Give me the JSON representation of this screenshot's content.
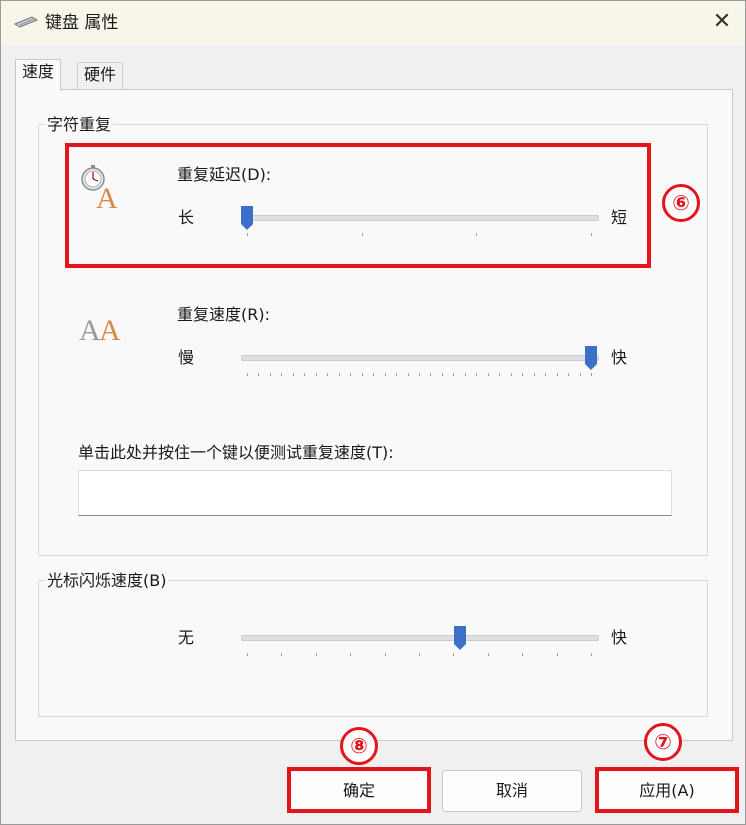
{
  "window": {
    "title": "键盘 属性",
    "close": "✕"
  },
  "tabs": [
    {
      "label": "速度",
      "active": true
    },
    {
      "label": "硬件",
      "active": false
    }
  ],
  "char_repeat": {
    "group_label": "字符重复",
    "delay": {
      "label": "重复延迟(D):",
      "left_label": "长",
      "right_label": "短",
      "value_fraction": 0.0
    },
    "rate": {
      "label": "重复速度(R):",
      "left_label": "慢",
      "right_label": "快",
      "value_fraction": 1.0
    },
    "test": {
      "label": "单击此处并按住一个键以便测试重复速度(T):",
      "value": ""
    }
  },
  "cursor_blink": {
    "group_label": "光标闪烁速度(B)",
    "left_label": "无",
    "right_label": "快",
    "value_fraction": 0.62
  },
  "buttons": {
    "ok": "确定",
    "cancel": "取消",
    "apply": "应用(A)"
  },
  "annotations": {
    "marker_6": "⑥",
    "marker_7": "⑦",
    "marker_8": "⑧"
  },
  "colors": {
    "accent": "#3c6fc8",
    "annotation_red": "#e3141b",
    "titlebar": "#f8f6e9"
  }
}
